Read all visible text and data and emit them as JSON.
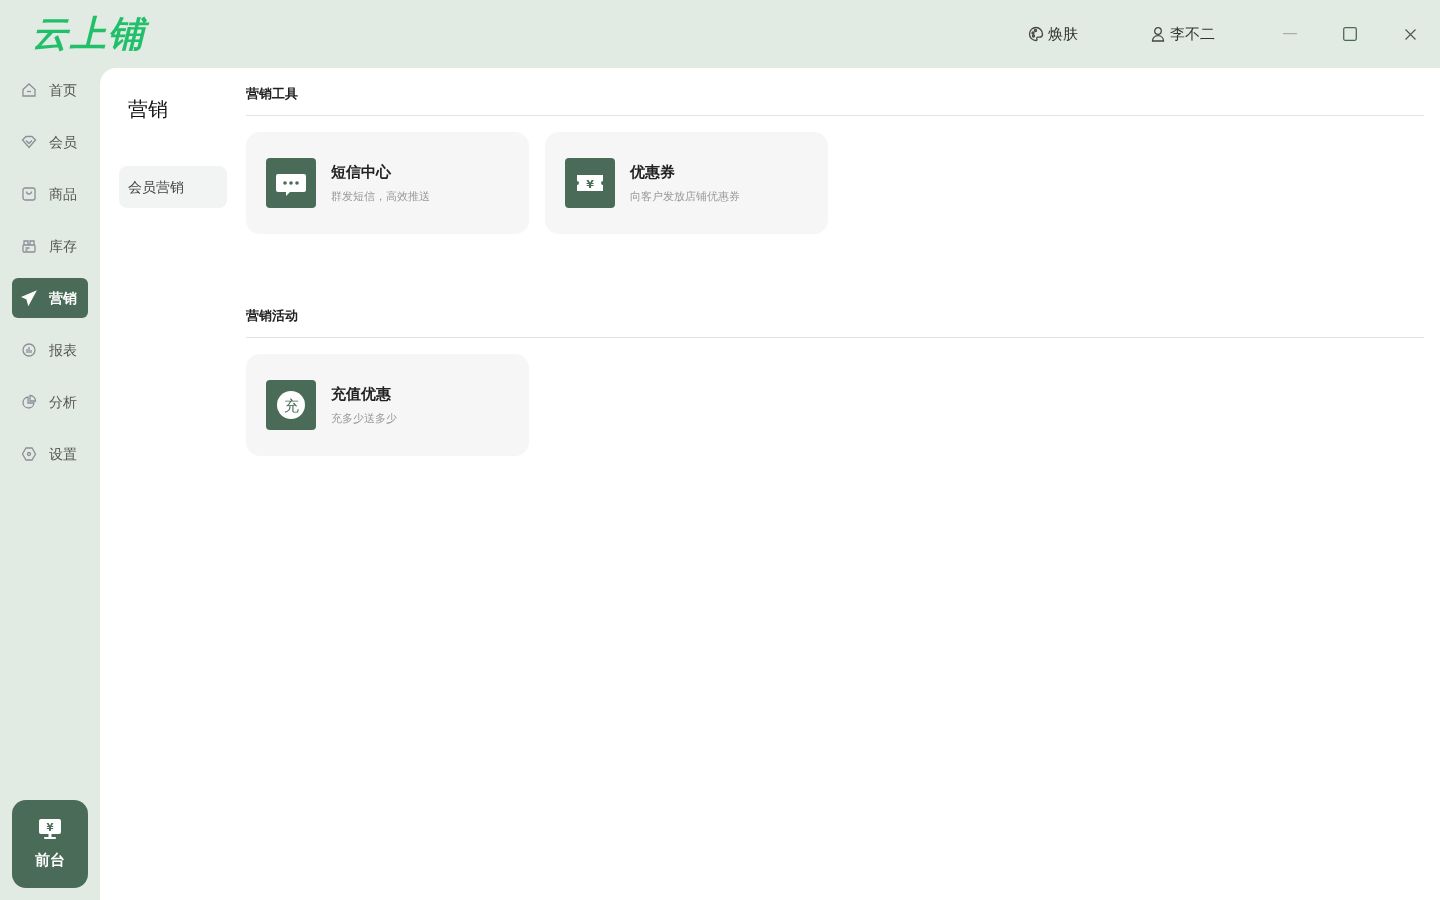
{
  "logo": "云上铺",
  "header": {
    "skin": "焕肤",
    "user": "李不二"
  },
  "nav": [
    {
      "label": "首页",
      "kind": "home",
      "selected": false
    },
    {
      "label": "会员",
      "kind": "diamond",
      "selected": false
    },
    {
      "label": "商品",
      "kind": "bag",
      "selected": false
    },
    {
      "label": "库存",
      "kind": "stock",
      "selected": false
    },
    {
      "label": "营销",
      "kind": "send",
      "selected": true
    },
    {
      "label": "报表",
      "kind": "chart",
      "selected": false
    },
    {
      "label": "分析",
      "kind": "pie",
      "selected": false
    },
    {
      "label": "设置",
      "kind": "gear",
      "selected": false
    }
  ],
  "frontdesk": {
    "label": "前台",
    "glyph": "¥"
  },
  "subnav": {
    "title": "营销",
    "items": [
      {
        "label": "会员营销",
        "selected": true
      }
    ]
  },
  "sections": [
    {
      "title": "营销工具",
      "cards": [
        {
          "kind": "chat",
          "title": "短信中心",
          "desc": "群发短信，高效推送"
        },
        {
          "kind": "coupon",
          "glyph": "¥",
          "title": "优惠券",
          "desc": "向客户发放店铺优惠券"
        }
      ]
    },
    {
      "title": "营销活动",
      "cards": [
        {
          "kind": "recharge",
          "glyph": "充",
          "title": "充值优惠",
          "desc": "充多少送多少"
        }
      ]
    }
  ]
}
